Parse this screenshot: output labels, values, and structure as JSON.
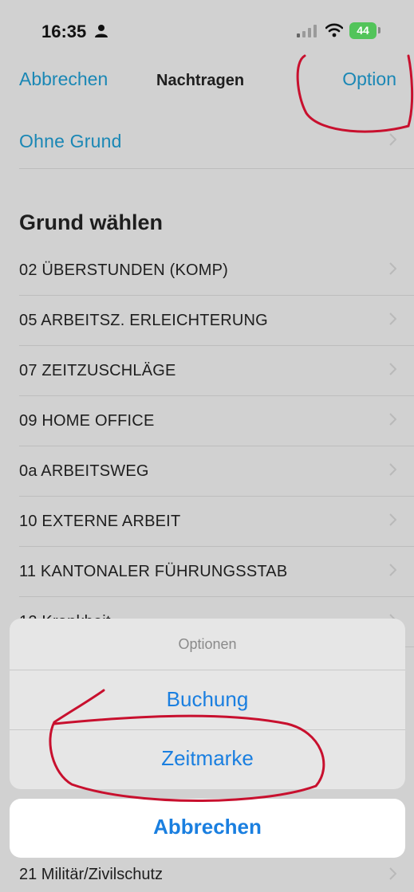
{
  "status": {
    "time": "16:35",
    "battery": "44"
  },
  "nav": {
    "cancel_label": "Abbrechen",
    "title": "Nachtragen",
    "option_label": "Option"
  },
  "no_reason": {
    "label": "Ohne Grund"
  },
  "section": {
    "title": "Grund wählen"
  },
  "reasons": [
    "02 ÜBERSTUNDEN (KOMP)",
    "05 ARBEITSZ. ERLEICHTERUNG",
    "07 ZEITZUSCHLÄGE",
    "09 HOME OFFICE",
    "0a ARBEITSWEG",
    "10 EXTERNE ARBEIT",
    "11 KANTONALER FÜHRUNGSSTAB",
    "12 Krankheit"
  ],
  "action_sheet": {
    "title": "Optionen",
    "buttons": [
      "Buchung",
      "Zeitmarke"
    ],
    "cancel_label": "Abbrechen"
  },
  "last_row": {
    "label": "21 Militär/Zivilschutz"
  },
  "colors": {
    "accent": "#1a87b5",
    "sheet_button": "#1a7fe0",
    "annotation": "#c8102e"
  }
}
